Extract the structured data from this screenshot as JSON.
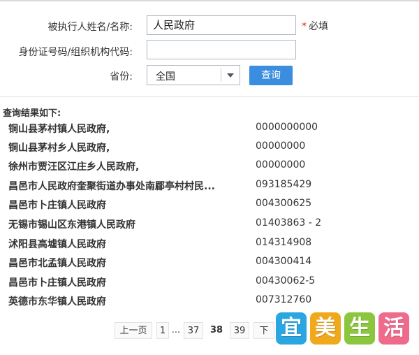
{
  "form": {
    "name_label": "被执行人姓名/名称:",
    "name_value": "人民政府",
    "required_star": "*",
    "required_text": "必填",
    "id_label": "身份证号码/组织机构代码:",
    "id_value": "",
    "province_label": "省份:",
    "province_value": "全国",
    "query_button": "查询"
  },
  "results": {
    "title": "查询结果如下:",
    "rows": [
      {
        "name": "铜山县茅村镇人民政府,",
        "code": "0000000000"
      },
      {
        "name": "铜山县茅村乡人民政府,",
        "code": "00000000"
      },
      {
        "name": "徐州市贾汪区江庄乡人民政府,",
        "code": "00000000"
      },
      {
        "name": "昌邑市人民政府奎聚街道办事处南郿亭村村民...",
        "code": "093185429"
      },
      {
        "name": "昌邑市卜庄镇人民政府",
        "code": "004300625"
      },
      {
        "name": "无锡市锡山区东港镇人民政府",
        "code": "01403863 - 2"
      },
      {
        "name": "沭阳县高墟镇人民政府",
        "code": "014314908"
      },
      {
        "name": "昌邑市北孟镇人民政府",
        "code": "004300414"
      },
      {
        "name": "昌邑市卜庄镇人民政府",
        "code": "00430062-5"
      },
      {
        "name": "英德市东华镇人民政府",
        "code": "007312760"
      }
    ]
  },
  "pager": {
    "prev": "上一页",
    "first": "1",
    "ellipsis": "...",
    "p37": "37",
    "current": "38",
    "p39": "39",
    "next_partial": "下"
  },
  "watermark": {
    "chars": [
      "宜",
      "美",
      "生",
      "活"
    ],
    "colors": [
      "#2aa6e0",
      "#f0a81c",
      "#8cc63f",
      "#f06a8c"
    ]
  }
}
